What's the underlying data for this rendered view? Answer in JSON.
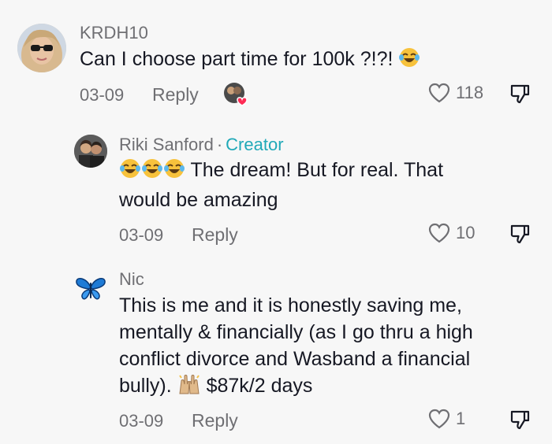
{
  "comments": [
    {
      "username": "KRDH10",
      "text": "Can I choose part time for 100k ?!?!",
      "date": "03-09",
      "reply_label": "Reply",
      "likes": "118",
      "avatar_icon": "woman-sunglasses-avatar"
    },
    {
      "username": "Riki Sanford",
      "separator": "·",
      "badge": "Creator",
      "text_line1": "The dream! But for real. That",
      "text_line2": "would be amazing",
      "date": "03-09",
      "reply_label": "Reply",
      "likes": "10",
      "avatar_icon": "couple-photo-avatar"
    },
    {
      "username": "Nic",
      "text_lines": [
        "This is me and it is honestly saving me,",
        "mentally & financially (as I go thru a high",
        "conflict divorce and Wasband a financial",
        "bully)."
      ],
      "text_tail": "$87k/2 days",
      "date": "03-09",
      "reply_label": "Reply",
      "likes": "1",
      "avatar_icon": "blue-butterfly-avatar"
    }
  ],
  "colors": {
    "background": "#f7f7f7",
    "text": "#161823",
    "muted": "#6f6f73",
    "creator_badge": "#20a9b8",
    "heart_red": "#fe2c55"
  }
}
